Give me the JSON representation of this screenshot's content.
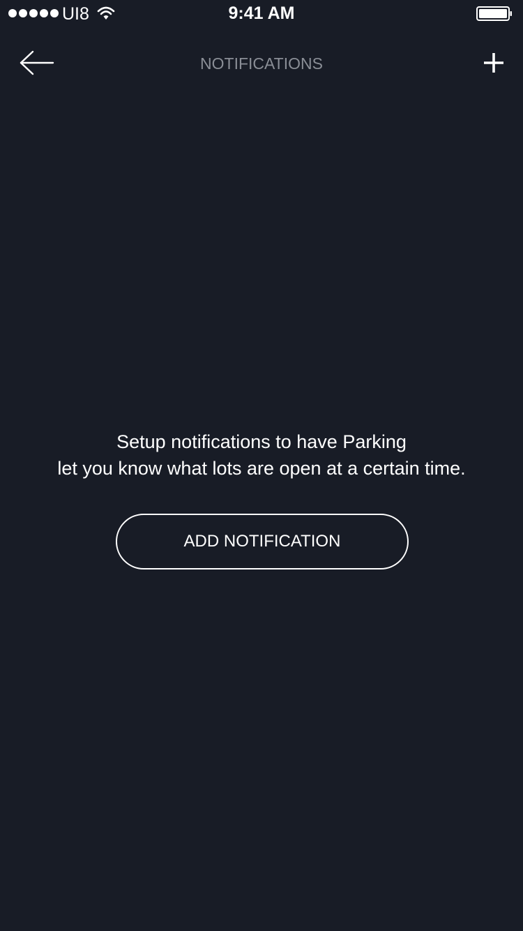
{
  "status_bar": {
    "carrier": "UI8",
    "time": "9:41 AM",
    "signal_strength_dots": 5,
    "battery_level": 1.0,
    "icons": [
      "signal-dots-icon",
      "wifi-icon",
      "battery-icon"
    ]
  },
  "nav": {
    "title": "NOTIFICATIONS",
    "back_icon": "arrow-left-icon",
    "add_icon": "plus-icon"
  },
  "empty_state": {
    "line1": "Setup notifications to have Parking",
    "line2": "let you know what lots are open at a certain time.",
    "button_label": "ADD NOTIFICATION"
  },
  "colors": {
    "background": "#181c26",
    "text": "#ffffff",
    "nav_title": "#8a8e96"
  }
}
